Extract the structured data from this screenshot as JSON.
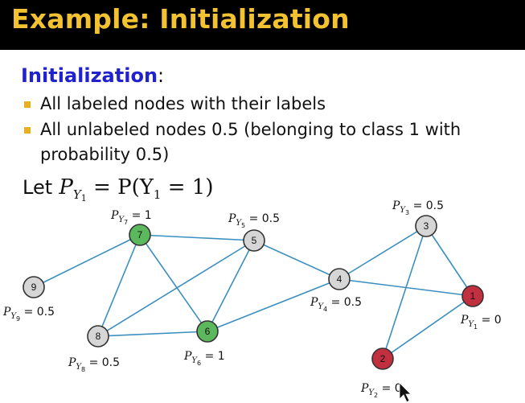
{
  "title": "Example: Initialization",
  "heading": "Initialization",
  "heading_colon": ":",
  "bullets": [
    {
      "lines": [
        "All labeled nodes with their labels"
      ]
    },
    {
      "lines": [
        "All unlabeled nodes 0.5 (belonging to class 1 with",
        "probability 0.5)"
      ]
    }
  ],
  "let_line": {
    "word": "Let",
    "formula_lhs": "P",
    "formula_sub": "Y",
    "formula_subsub": "1",
    "formula_eq": " = P(Y",
    "formula_rhs_sub": "1",
    "formula_end": " = 1)"
  },
  "colors": {
    "title_text": "#f2c230",
    "heading": "#2222cc",
    "bullet": "#e8b020",
    "edge": "#3b8fc0",
    "node_unlabeled": "#d6d6d6",
    "node_class1": "#5cb85c",
    "node_class0": "#c2303f"
  },
  "graph": {
    "nodes": [
      {
        "id": "1",
        "state": "class0",
        "prob_label": "= 0",
        "sub": "1"
      },
      {
        "id": "2",
        "state": "class0",
        "prob_label": "= 0",
        "sub": "2"
      },
      {
        "id": "3",
        "state": "unlabeled",
        "prob_label": "= 0.5",
        "sub": "3"
      },
      {
        "id": "4",
        "state": "unlabeled",
        "prob_label": "= 0.5",
        "sub": "4"
      },
      {
        "id": "5",
        "state": "unlabeled",
        "prob_label": "= 0.5",
        "sub": "5"
      },
      {
        "id": "6",
        "state": "class1",
        "prob_label": "= 1",
        "sub": "6"
      },
      {
        "id": "7",
        "state": "class1",
        "prob_label": "= 1",
        "sub": "7"
      },
      {
        "id": "8",
        "state": "unlabeled",
        "prob_label": "= 0.5",
        "sub": "8"
      },
      {
        "id": "9",
        "state": "unlabeled",
        "prob_label": "= 0.5",
        "sub": "9"
      }
    ],
    "edges": [
      [
        "9",
        "7"
      ],
      [
        "7",
        "5"
      ],
      [
        "7",
        "8"
      ],
      [
        "7",
        "6"
      ],
      [
        "8",
        "5"
      ],
      [
        "8",
        "6"
      ],
      [
        "5",
        "6"
      ],
      [
        "5",
        "4"
      ],
      [
        "6",
        "4"
      ],
      [
        "4",
        "3"
      ],
      [
        "4",
        "1"
      ],
      [
        "3",
        "1"
      ],
      [
        "3",
        "2"
      ],
      [
        "1",
        "2"
      ]
    ],
    "prob_prefix": "P",
    "prob_sub_letter": "Y"
  }
}
